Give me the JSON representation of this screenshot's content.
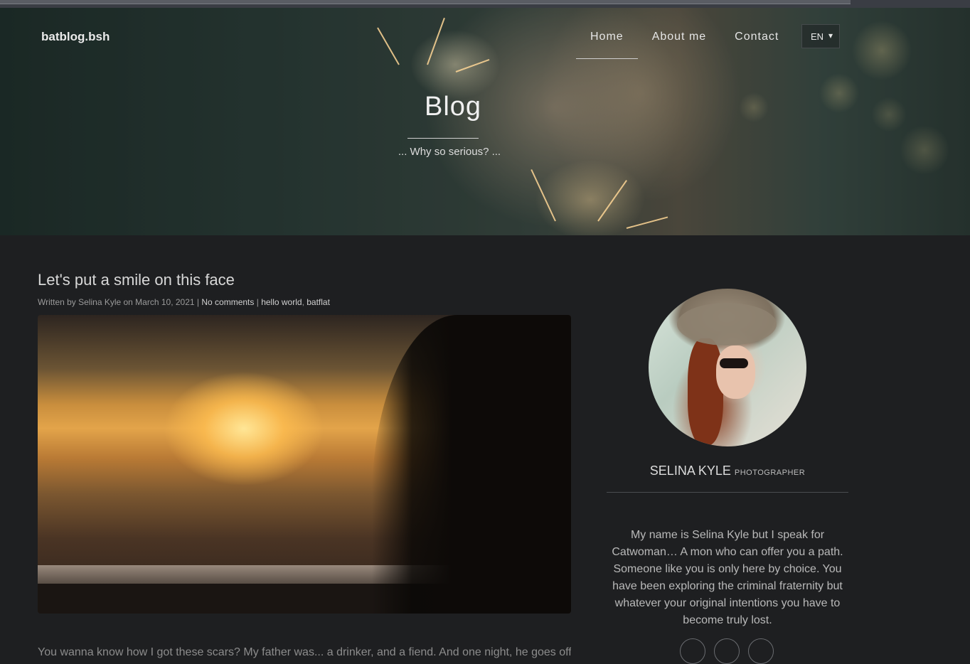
{
  "brand": "batblog.bsh",
  "nav": {
    "items": [
      "Home",
      "About me",
      "Contact"
    ],
    "language": "EN",
    "language_caret": "▾"
  },
  "hero": {
    "title": "Blog",
    "subtitle": "... Why so serious? ..."
  },
  "post": {
    "title": "Let's put a smile on this face",
    "meta_prefix": "Written by Selina Kyle on March 10, 2021 | ",
    "comments": "No comments",
    "meta_sep": " | ",
    "tag1": "hello world",
    "tag_sep": ", ",
    "tag2": "batflat",
    "text": "You wanna know how I got these scars? My father was... a drinker, and a fiend. And one night, he goes off"
  },
  "profile": {
    "name": "SELINA KYLE",
    "role": "PHOTOGRAPHER",
    "bio": "My name is Selina Kyle but I speak for Catwoman… A mon who can offer you a path. Someone like you is only here by choice. You have been exploring the criminal fraternity but whatever your original intentions you have to become truly lost."
  },
  "colors": {
    "background": "#1e1f21",
    "text": "#c8c8c8",
    "accent": "#e6e6e6"
  }
}
